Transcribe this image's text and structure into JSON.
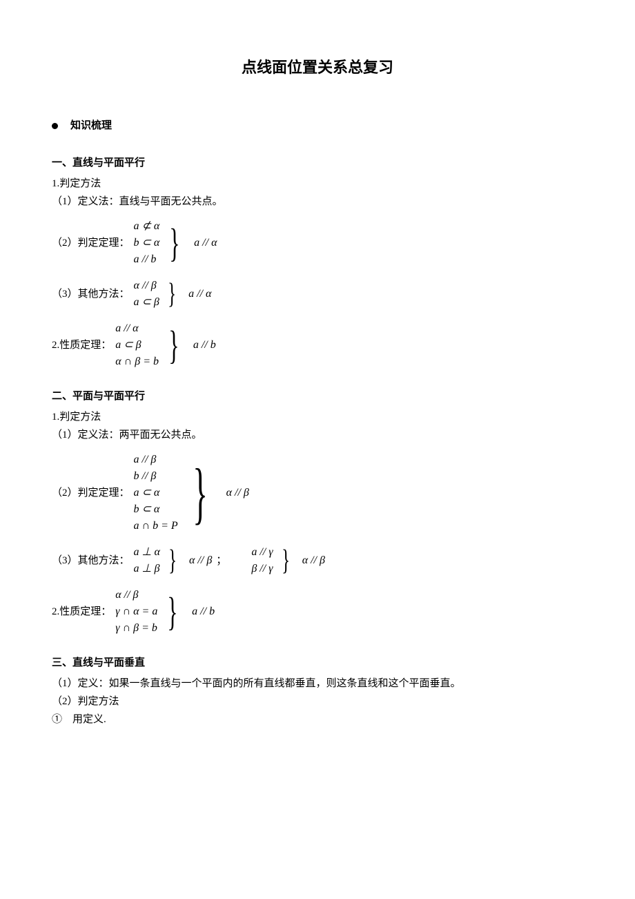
{
  "title": "点线面位置关系总复习",
  "knowledgeLabel": "知识梳理",
  "sec1": {
    "heading": "一、直线与平面平行",
    "p1": "1.判定方法",
    "p1_1": "（1）定义法：直线与平面无公共点。",
    "p1_2_label": "（2）判定定理：",
    "p1_2_prem": [
      "a ⊄ α",
      "b ⊂ α",
      "a // b"
    ],
    "p1_2_conc": "a // α",
    "p1_3_label": "（3）其他方法：",
    "p1_3_prem": [
      "α // β",
      "a ⊂ β"
    ],
    "p1_3_conc": "a // α",
    "p2_label": "2.性质定理：",
    "p2_prem": [
      "a // α",
      "a ⊂ β",
      "α ∩ β = b"
    ],
    "p2_conc": "a // b"
  },
  "sec2": {
    "heading": "二、平面与平面平行",
    "p1": "1.判定方法",
    "p1_1": "（1）定义法：两平面无公共点。",
    "p1_2_label": "（2）判定定理：",
    "p1_2_prem": [
      "a // β",
      "b // β",
      "a ⊂ α",
      "b ⊂ α",
      "a ∩ b = P"
    ],
    "p1_2_conc": "α // β",
    "p1_3_label": "（3）其他方法：",
    "p1_3a_prem": [
      "a ⊥ α",
      "a ⊥ β"
    ],
    "p1_3a_conc": "α // β",
    "sep": "；",
    "p1_3b_prem": [
      "a // γ",
      "β // γ"
    ],
    "p1_3b_conc": "α // β",
    "p2_label": "2.性质定理：",
    "p2_prem": [
      "α // β",
      "γ ∩ α = a",
      "γ ∩ β = b"
    ],
    "p2_conc": "a // b"
  },
  "sec3": {
    "heading": "三、直线与平面垂直",
    "p1": "（1）定义：如果一条直线与一个平面内的所有直线都垂直，则这条直线和这个平面垂直。",
    "p2": "（2）判定方法",
    "p3": "①　用定义."
  }
}
